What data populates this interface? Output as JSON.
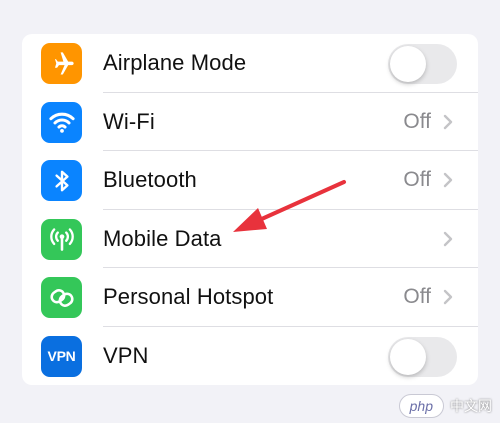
{
  "settings": {
    "items": [
      {
        "label": "Airplane Mode",
        "icon": "airplane-icon",
        "color": "#ff9500",
        "control": "toggle",
        "toggle_on": false
      },
      {
        "label": "Wi-Fi",
        "value": "Off",
        "icon": "wifi-icon",
        "color": "#0a84ff",
        "control": "chevron"
      },
      {
        "label": "Bluetooth",
        "value": "Off",
        "icon": "bluetooth-icon",
        "color": "#0a84ff",
        "control": "chevron"
      },
      {
        "label": "Mobile Data",
        "value": "",
        "icon": "antenna-icon",
        "color": "#34c759",
        "control": "chevron"
      },
      {
        "label": "Personal Hotspot",
        "value": "Off",
        "icon": "chain-link-icon",
        "color": "#34c759",
        "control": "chevron"
      },
      {
        "label": "VPN",
        "icon": "vpn-icon",
        "icon_text": "VPN",
        "color": "#0a6fe0",
        "control": "toggle",
        "toggle_on": false
      }
    ]
  },
  "annotation": {
    "color": "#e8323c"
  },
  "watermark": {
    "logo": "php",
    "text": "中文网"
  }
}
